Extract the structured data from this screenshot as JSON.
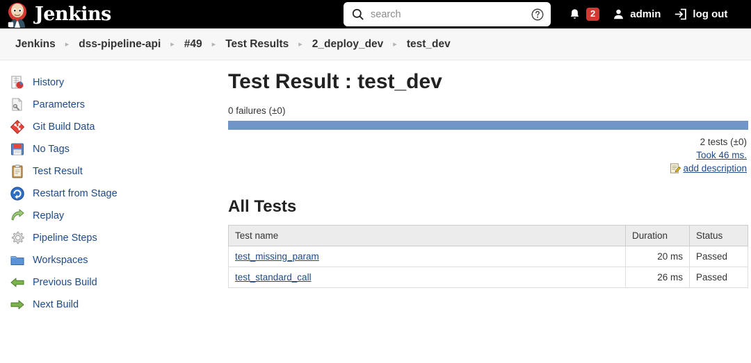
{
  "header": {
    "brand": "Jenkins",
    "logo_icon": "jenkins-butler-logo",
    "search": {
      "icon": "search-icon",
      "placeholder": "search",
      "value": "",
      "help_icon": "help-circle-icon"
    },
    "notifications": {
      "icon": "bell-icon",
      "count": "2",
      "badge_color": "#d33833"
    },
    "user": {
      "icon": "person-icon",
      "label": "admin"
    },
    "logout": {
      "icon": "logout-icon",
      "label": "log out"
    }
  },
  "breadcrumb": {
    "separator": "▸",
    "items": [
      {
        "label": "Jenkins"
      },
      {
        "label": "dss-pipeline-api"
      },
      {
        "label": "#49"
      },
      {
        "label": "Test Results"
      },
      {
        "label": "2_deploy_dev"
      },
      {
        "label": "test_dev"
      }
    ]
  },
  "sidebar": {
    "items": [
      {
        "label": "History",
        "icon": "history-chart-icon"
      },
      {
        "label": "Parameters",
        "icon": "parameters-document-icon"
      },
      {
        "label": "Git Build Data",
        "icon": "git-diamond-icon"
      },
      {
        "label": "No Tags",
        "icon": "floppy-disk-icon"
      },
      {
        "label": "Test Result",
        "icon": "clipboard-icon"
      },
      {
        "label": "Restart from Stage",
        "icon": "restart-circle-icon"
      },
      {
        "label": "Replay",
        "icon": "replay-arrow-icon"
      },
      {
        "label": "Pipeline Steps",
        "icon": "gear-icon"
      },
      {
        "label": "Workspaces",
        "icon": "folder-icon"
      },
      {
        "label": "Previous Build",
        "icon": "arrow-left-icon"
      },
      {
        "label": "Next Build",
        "icon": "arrow-right-icon"
      }
    ]
  },
  "main": {
    "title": "Test Result : test_dev",
    "failures_text": "0 failures (±0)",
    "progress": {
      "pass_percent": 100,
      "pass_color": "#6f96c6"
    },
    "stats": {
      "tests_text": "2 tests (±0)",
      "duration_link": "Took 46 ms.",
      "add_description_label": "add description",
      "add_description_icon": "edit-notepad-icon"
    },
    "all_tests": {
      "heading": "All Tests",
      "columns": {
        "name": "Test name",
        "duration": "Duration",
        "status": "Status"
      },
      "rows": [
        {
          "name": "test_missing_param",
          "duration": "20 ms",
          "status": "Passed"
        },
        {
          "name": "test_standard_call",
          "duration": "26 ms",
          "status": "Passed"
        }
      ]
    }
  }
}
